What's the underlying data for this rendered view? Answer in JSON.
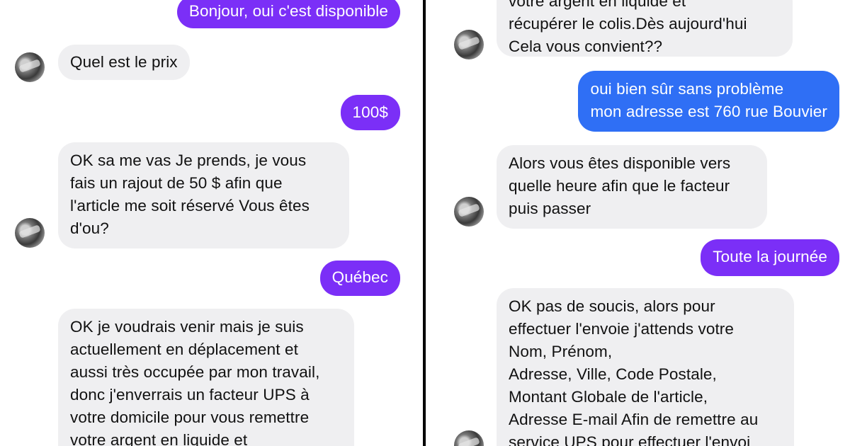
{
  "left_conversation": {
    "messages": [
      {
        "sender": "me",
        "text": "Bonjour, oui c'est disponible"
      },
      {
        "sender": "them",
        "text": "Quel est le prix"
      },
      {
        "sender": "me",
        "text": "100$"
      },
      {
        "sender": "them",
        "text": "OK sa me vas Je prends, je vous\nfais un rajout de 50 $ afin que\nl'article me soit réservé Vous êtes\nd'ou?"
      },
      {
        "sender": "me",
        "text": "Québec"
      },
      {
        "sender": "them",
        "text": "OK je voudrais venir mais je suis\nactuellement en déplacement et\naussi très occupée par mon travail,\ndonc j'enverrais un facteur UPS à\nvotre domicile pour vous remettre\nvotre argent en liquide et"
      }
    ]
  },
  "right_conversation": {
    "messages": [
      {
        "sender": "them",
        "text": "votre argent en liquide et\nrécupérer le colis.Dès aujourd'hui\nCela vous convient??"
      },
      {
        "sender": "me",
        "text": "oui bien sûr sans problème\nmon adresse est 760 rue Bouvier"
      },
      {
        "sender": "them",
        "text": "Alors vous êtes disponible vers\nquelle heure afin que le facteur\npuis passer"
      },
      {
        "sender": "me",
        "text": "Toute la journée"
      },
      {
        "sender": "them",
        "text": "OK pas de soucis, alors pour\neffectuer l'envoie j'attends votre\nNom, Prénom,\nAdresse, Ville, Code Postale,\nMontant Globale de l'article,\nAdresse E-mail Afin de remettre au\nservice UPS pour effectuer l'envoi"
      }
    ]
  },
  "colors": {
    "outgoing_purple": "#7b2ff7",
    "outgoing_blue": "#2f6ff5",
    "incoming_gray": "#efeff1",
    "divider": "#000000"
  },
  "icons": [
    "avatar-icon"
  ]
}
